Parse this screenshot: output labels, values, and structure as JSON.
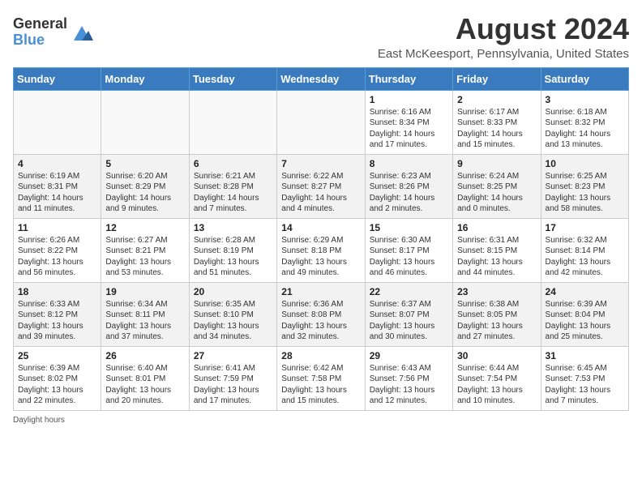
{
  "logo": {
    "general": "General",
    "blue": "Blue"
  },
  "title": "August 2024",
  "location": "East McKeesport, Pennsylvania, United States",
  "daylight_note": "Daylight hours",
  "days_of_week": [
    "Sunday",
    "Monday",
    "Tuesday",
    "Wednesday",
    "Thursday",
    "Friday",
    "Saturday"
  ],
  "weeks": [
    [
      {
        "day": "",
        "empty": true
      },
      {
        "day": "",
        "empty": true
      },
      {
        "day": "",
        "empty": true
      },
      {
        "day": "",
        "empty": true
      },
      {
        "day": "1",
        "sunrise": "6:16 AM",
        "sunset": "8:34 PM",
        "daylight": "14 hours and 17 minutes."
      },
      {
        "day": "2",
        "sunrise": "6:17 AM",
        "sunset": "8:33 PM",
        "daylight": "14 hours and 15 minutes."
      },
      {
        "day": "3",
        "sunrise": "6:18 AM",
        "sunset": "8:32 PM",
        "daylight": "14 hours and 13 minutes."
      }
    ],
    [
      {
        "day": "4",
        "sunrise": "6:19 AM",
        "sunset": "8:31 PM",
        "daylight": "14 hours and 11 minutes."
      },
      {
        "day": "5",
        "sunrise": "6:20 AM",
        "sunset": "8:29 PM",
        "daylight": "14 hours and 9 minutes."
      },
      {
        "day": "6",
        "sunrise": "6:21 AM",
        "sunset": "8:28 PM",
        "daylight": "14 hours and 7 minutes."
      },
      {
        "day": "7",
        "sunrise": "6:22 AM",
        "sunset": "8:27 PM",
        "daylight": "14 hours and 4 minutes."
      },
      {
        "day": "8",
        "sunrise": "6:23 AM",
        "sunset": "8:26 PM",
        "daylight": "14 hours and 2 minutes."
      },
      {
        "day": "9",
        "sunrise": "6:24 AM",
        "sunset": "8:25 PM",
        "daylight": "14 hours and 0 minutes."
      },
      {
        "day": "10",
        "sunrise": "6:25 AM",
        "sunset": "8:23 PM",
        "daylight": "13 hours and 58 minutes."
      }
    ],
    [
      {
        "day": "11",
        "sunrise": "6:26 AM",
        "sunset": "8:22 PM",
        "daylight": "13 hours and 56 minutes."
      },
      {
        "day": "12",
        "sunrise": "6:27 AM",
        "sunset": "8:21 PM",
        "daylight": "13 hours and 53 minutes."
      },
      {
        "day": "13",
        "sunrise": "6:28 AM",
        "sunset": "8:19 PM",
        "daylight": "13 hours and 51 minutes."
      },
      {
        "day": "14",
        "sunrise": "6:29 AM",
        "sunset": "8:18 PM",
        "daylight": "13 hours and 49 minutes."
      },
      {
        "day": "15",
        "sunrise": "6:30 AM",
        "sunset": "8:17 PM",
        "daylight": "13 hours and 46 minutes."
      },
      {
        "day": "16",
        "sunrise": "6:31 AM",
        "sunset": "8:15 PM",
        "daylight": "13 hours and 44 minutes."
      },
      {
        "day": "17",
        "sunrise": "6:32 AM",
        "sunset": "8:14 PM",
        "daylight": "13 hours and 42 minutes."
      }
    ],
    [
      {
        "day": "18",
        "sunrise": "6:33 AM",
        "sunset": "8:12 PM",
        "daylight": "13 hours and 39 minutes."
      },
      {
        "day": "19",
        "sunrise": "6:34 AM",
        "sunset": "8:11 PM",
        "daylight": "13 hours and 37 minutes."
      },
      {
        "day": "20",
        "sunrise": "6:35 AM",
        "sunset": "8:10 PM",
        "daylight": "13 hours and 34 minutes."
      },
      {
        "day": "21",
        "sunrise": "6:36 AM",
        "sunset": "8:08 PM",
        "daylight": "13 hours and 32 minutes."
      },
      {
        "day": "22",
        "sunrise": "6:37 AM",
        "sunset": "8:07 PM",
        "daylight": "13 hours and 30 minutes."
      },
      {
        "day": "23",
        "sunrise": "6:38 AM",
        "sunset": "8:05 PM",
        "daylight": "13 hours and 27 minutes."
      },
      {
        "day": "24",
        "sunrise": "6:39 AM",
        "sunset": "8:04 PM",
        "daylight": "13 hours and 25 minutes."
      }
    ],
    [
      {
        "day": "25",
        "sunrise": "6:39 AM",
        "sunset": "8:02 PM",
        "daylight": "13 hours and 22 minutes."
      },
      {
        "day": "26",
        "sunrise": "6:40 AM",
        "sunset": "8:01 PM",
        "daylight": "13 hours and 20 minutes."
      },
      {
        "day": "27",
        "sunrise": "6:41 AM",
        "sunset": "7:59 PM",
        "daylight": "13 hours and 17 minutes."
      },
      {
        "day": "28",
        "sunrise": "6:42 AM",
        "sunset": "7:58 PM",
        "daylight": "13 hours and 15 minutes."
      },
      {
        "day": "29",
        "sunrise": "6:43 AM",
        "sunset": "7:56 PM",
        "daylight": "13 hours and 12 minutes."
      },
      {
        "day": "30",
        "sunrise": "6:44 AM",
        "sunset": "7:54 PM",
        "daylight": "13 hours and 10 minutes."
      },
      {
        "day": "31",
        "sunrise": "6:45 AM",
        "sunset": "7:53 PM",
        "daylight": "13 hours and 7 minutes."
      }
    ]
  ]
}
